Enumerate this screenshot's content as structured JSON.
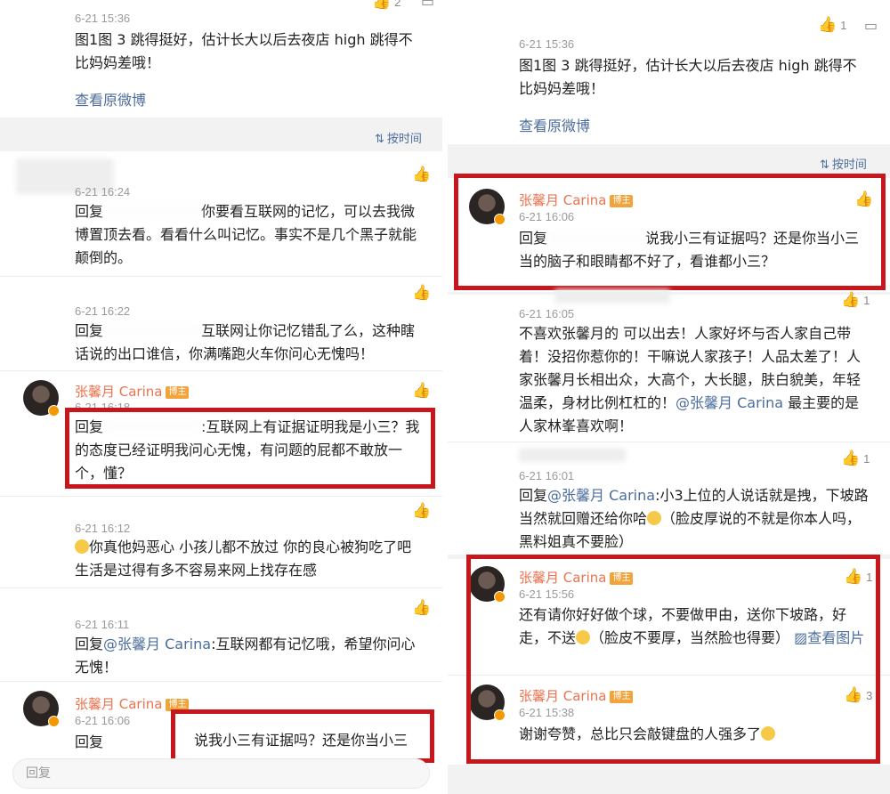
{
  "left": {
    "top_like_count": "2",
    "post": {
      "time": "6-21 15:36",
      "text": "图1图 3 跳得挺好，估计长大以后去夜店 high 跳得不比妈妈差哦！",
      "view_original": "查看原微博"
    },
    "sort_label": "按时间",
    "comments": [
      {
        "time": "6-21 16:24",
        "prefix": "回复",
        "text": "你要看互联网的记忆，可以去我微博置顶去看。看看什么叫记忆。事实不是几个黑子就能颠倒的。"
      },
      {
        "time": "6-21 16:22",
        "prefix": "回复",
        "text": "互联网让你记忆错乱了么，这种瞎话说的出口谁信，你满嘴跑火车你问心无愧吗！"
      },
      {
        "name": "张馨月 Carina",
        "badge": "博主",
        "time": "6-21 16:18",
        "prefix": "回复",
        "text": ":互联网上有证据证明我是小三？我的态度已经证明我问心无愧，有问题的屁都不敢放一个，懂？"
      },
      {
        "time": "6-21 16:12",
        "text": "你真他妈恶心 小孩儿都不放过 你的良心被狗吃了吧 生活是过得有多不容易来网上找存在感"
      },
      {
        "time": "6-21 16:11",
        "prefix": "回复",
        "mention": "@张馨月 Carina",
        "text": ":互联网都有记忆哦，希望你问心无愧！"
      },
      {
        "name": "张馨月 Carina",
        "badge": "博主",
        "time": "6-21 16:06",
        "prefix": "回复",
        "text": "说我小三有证据吗？还是你当小三"
      }
    ],
    "reply_placeholder": "回复"
  },
  "right": {
    "top_like_count": "1",
    "post": {
      "time": "6-21 15:36",
      "text": "图1图 3 跳得挺好，估计长大以后去夜店 high 跳得不比妈妈差哦！",
      "view_original": "查看原微博"
    },
    "sort_label": "按时间",
    "comments": [
      {
        "name": "张馨月 Carina",
        "badge": "博主",
        "time": "6-21 16:06",
        "prefix": "回复",
        "text": "说我小三有证据吗？还是你当小三当的脑子和眼睛都不好了，看谁都小三？"
      },
      {
        "time": "6-21 16:05",
        "like_count": "1",
        "text": "不喜欢张馨月的 可以出去！人家好坏与否人家自己带着！没招你惹你的！干嘛说人家孩子！人品太差了！人家张馨月长相出众，大高个，大长腿，肤白貌美，年轻 温柔，身材比例杠杠的！",
        "mention": "@张馨月 Carina",
        "text_after": " 最主要的是人家林峯喜欢啊！"
      },
      {
        "time": "6-21 16:01",
        "like_count": "1",
        "prefix": "回复",
        "mention": "@张馨月 Carina",
        "text": ":小3上位的人说话就是拽，下坡路当然就回赠还给你哈",
        "text_after": "（脸皮厚说的不就是你本人吗，黑料姐真不要脸）"
      },
      {
        "name": "张馨月 Carina",
        "badge": "博主",
        "time": "6-21 15:56",
        "like_count": "1",
        "text": "还有请你好好做个球，不要做甲由，送你下坡路，好走，不送",
        "text_after": "（脸皮不要厚，当然脸也得要）",
        "view_image": "查看图片"
      },
      {
        "name": "张馨月 Carina",
        "badge": "博主",
        "time": "6-21 15:38",
        "like_count": "3",
        "text": "谢谢夸赞，总比只会敲键盘的人强多了"
      }
    ]
  }
}
